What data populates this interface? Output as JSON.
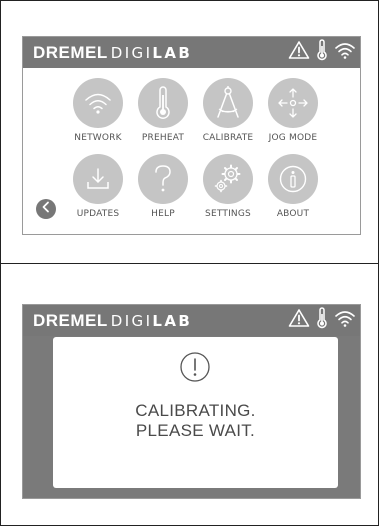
{
  "screens": {
    "main_menu": {
      "brand": {
        "part1": "DREMEL",
        "part2a": "DIGI",
        "part2b": "LAB"
      },
      "status_icons": [
        "warning-icon",
        "thermometer-icon",
        "wifi-icon"
      ],
      "tiles": [
        {
          "label": "NETWORK",
          "icon": "wifi-icon"
        },
        {
          "label": "PREHEAT",
          "icon": "thermometer-icon"
        },
        {
          "label": "CALIBRATE",
          "icon": "compass-icon"
        },
        {
          "label": "JOG MODE",
          "icon": "move-arrows-icon"
        },
        {
          "label": "UPDATES",
          "icon": "download-icon"
        },
        {
          "label": "HELP",
          "icon": "question-icon"
        },
        {
          "label": "SETTINGS",
          "icon": "gears-icon"
        },
        {
          "label": "ABOUT",
          "icon": "info-icon"
        }
      ],
      "back_icon": "chevron-left-icon"
    },
    "calibrating": {
      "brand": {
        "part1": "DREMEL",
        "part2a": "DIGI",
        "part2b": "LAB"
      },
      "status_icons": [
        "warning-icon",
        "thermometer-icon",
        "wifi-icon"
      ],
      "dialog": {
        "icon": "exclamation-circle-icon",
        "line1": "CALIBRATING.",
        "line2": "PLEASE WAIT."
      }
    }
  },
  "colors": {
    "header": "#777777",
    "tile": "#c5c5c5",
    "dialog_backdrop": "#7a7a7a",
    "text": "#555555"
  }
}
